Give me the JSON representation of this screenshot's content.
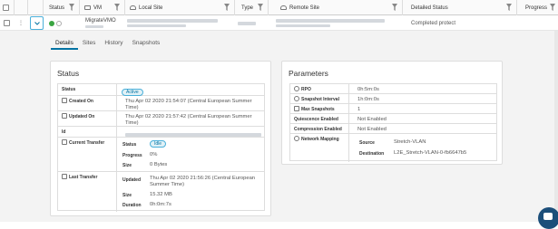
{
  "header": {
    "col_status": "Status",
    "col_vm": "VM",
    "col_local_site": "Local Site",
    "col_type": "Type",
    "col_remote_site": "Remote Site",
    "col_detailed_status": "Detailed Status",
    "col_progress": "Progress"
  },
  "row": {
    "vm_name": "MigrateVMO",
    "detailed_status": "Completed protect"
  },
  "tabs": [
    "Details",
    "Sites",
    "History",
    "Snapshots"
  ],
  "status_card": {
    "title": "Status",
    "status_label": "Status",
    "status_value": "Active",
    "created_label": "Created On",
    "created_value": "Thu Apr 02 2020 21:54:07 (Central European Summer Time)",
    "updated_label": "Updated On",
    "updated_value": "Thu Apr 02 2020 21:57:42 (Central European Summer Time)",
    "id_label": "Id",
    "current_transfer_label": "Current Transfer",
    "ct_status_key": "Status",
    "ct_status_value": "Idle",
    "ct_progress_key": "Progress",
    "ct_progress_value": "0%",
    "ct_size_key": "Size",
    "ct_size_value": "0 Bytes",
    "last_transfer_label": "Last Transfer",
    "lt_updated_key": "Updated",
    "lt_updated_value": "Thu Apr 02 2020 21:56:26 (Central European Summer Time)",
    "lt_size_key": "Size",
    "lt_size_value": "15.32 MB",
    "lt_duration_key": "Duration",
    "lt_duration_value": "0h:0m:7s"
  },
  "params_card": {
    "title": "Parameters",
    "rpo_label": "RPO",
    "rpo_value": "0h:5m:0s",
    "snap_interval_label": "Snapshot Interval",
    "snap_interval_value": "1h:0m:0s",
    "max_snap_label": "Max Snapshots",
    "max_snap_value": "1",
    "quiescence_label": "Quiescence Enabled",
    "quiescence_value": "Not Enabled",
    "compression_label": "Compression Enabled",
    "compression_value": "Not Enabled",
    "net_mapping_label": "Network Mapping",
    "nm_source_key": "Source",
    "nm_source_value": "Stretch-VLAN",
    "nm_dest_key": "Destination",
    "nm_dest_value": "L2E_Stretch-VLAN-0-fb6647b5"
  },
  "colors": {
    "accent": "#0072a3",
    "pill_bg": "#e1f1f6",
    "detail_bg": "#f3f3f3",
    "vm_green": "#3aa541"
  }
}
